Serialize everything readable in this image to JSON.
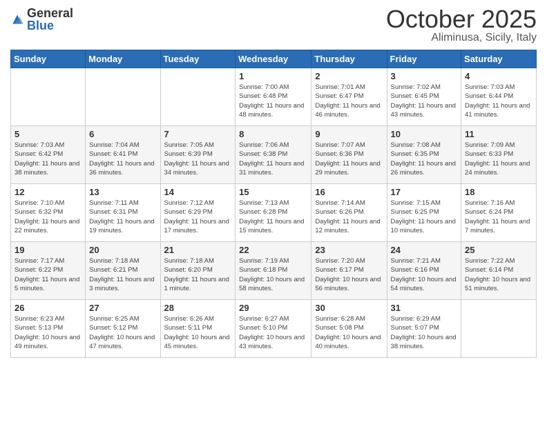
{
  "logo": {
    "general": "General",
    "blue": "Blue"
  },
  "header": {
    "month": "October 2025",
    "location": "Aliminusa, Sicily, Italy"
  },
  "weekdays": [
    "Sunday",
    "Monday",
    "Tuesday",
    "Wednesday",
    "Thursday",
    "Friday",
    "Saturday"
  ],
  "weeks": [
    [
      {
        "day": "",
        "info": ""
      },
      {
        "day": "",
        "info": ""
      },
      {
        "day": "",
        "info": ""
      },
      {
        "day": "1",
        "info": "Sunrise: 7:00 AM\nSunset: 6:48 PM\nDaylight: 11 hours\nand 48 minutes."
      },
      {
        "day": "2",
        "info": "Sunrise: 7:01 AM\nSunset: 6:47 PM\nDaylight: 11 hours\nand 46 minutes."
      },
      {
        "day": "3",
        "info": "Sunrise: 7:02 AM\nSunset: 6:45 PM\nDaylight: 11 hours\nand 43 minutes."
      },
      {
        "day": "4",
        "info": "Sunrise: 7:03 AM\nSunset: 6:44 PM\nDaylight: 11 hours\nand 41 minutes."
      }
    ],
    [
      {
        "day": "5",
        "info": "Sunrise: 7:03 AM\nSunset: 6:42 PM\nDaylight: 11 hours\nand 38 minutes."
      },
      {
        "day": "6",
        "info": "Sunrise: 7:04 AM\nSunset: 6:41 PM\nDaylight: 11 hours\nand 36 minutes."
      },
      {
        "day": "7",
        "info": "Sunrise: 7:05 AM\nSunset: 6:39 PM\nDaylight: 11 hours\nand 34 minutes."
      },
      {
        "day": "8",
        "info": "Sunrise: 7:06 AM\nSunset: 6:38 PM\nDaylight: 11 hours\nand 31 minutes."
      },
      {
        "day": "9",
        "info": "Sunrise: 7:07 AM\nSunset: 6:36 PM\nDaylight: 11 hours\nand 29 minutes."
      },
      {
        "day": "10",
        "info": "Sunrise: 7:08 AM\nSunset: 6:35 PM\nDaylight: 11 hours\nand 26 minutes."
      },
      {
        "day": "11",
        "info": "Sunrise: 7:09 AM\nSunset: 6:33 PM\nDaylight: 11 hours\nand 24 minutes."
      }
    ],
    [
      {
        "day": "12",
        "info": "Sunrise: 7:10 AM\nSunset: 6:32 PM\nDaylight: 11 hours\nand 22 minutes."
      },
      {
        "day": "13",
        "info": "Sunrise: 7:11 AM\nSunset: 6:31 PM\nDaylight: 11 hours\nand 19 minutes."
      },
      {
        "day": "14",
        "info": "Sunrise: 7:12 AM\nSunset: 6:29 PM\nDaylight: 11 hours\nand 17 minutes."
      },
      {
        "day": "15",
        "info": "Sunrise: 7:13 AM\nSunset: 6:28 PM\nDaylight: 11 hours\nand 15 minutes."
      },
      {
        "day": "16",
        "info": "Sunrise: 7:14 AM\nSunset: 6:26 PM\nDaylight: 11 hours\nand 12 minutes."
      },
      {
        "day": "17",
        "info": "Sunrise: 7:15 AM\nSunset: 6:25 PM\nDaylight: 11 hours\nand 10 minutes."
      },
      {
        "day": "18",
        "info": "Sunrise: 7:16 AM\nSunset: 6:24 PM\nDaylight: 11 hours\nand 7 minutes."
      }
    ],
    [
      {
        "day": "19",
        "info": "Sunrise: 7:17 AM\nSunset: 6:22 PM\nDaylight: 11 hours\nand 5 minutes."
      },
      {
        "day": "20",
        "info": "Sunrise: 7:18 AM\nSunset: 6:21 PM\nDaylight: 11 hours\nand 3 minutes."
      },
      {
        "day": "21",
        "info": "Sunrise: 7:18 AM\nSunset: 6:20 PM\nDaylight: 11 hours\nand 1 minute."
      },
      {
        "day": "22",
        "info": "Sunrise: 7:19 AM\nSunset: 6:18 PM\nDaylight: 10 hours\nand 58 minutes."
      },
      {
        "day": "23",
        "info": "Sunrise: 7:20 AM\nSunset: 6:17 PM\nDaylight: 10 hours\nand 56 minutes."
      },
      {
        "day": "24",
        "info": "Sunrise: 7:21 AM\nSunset: 6:16 PM\nDaylight: 10 hours\nand 54 minutes."
      },
      {
        "day": "25",
        "info": "Sunrise: 7:22 AM\nSunset: 6:14 PM\nDaylight: 10 hours\nand 51 minutes."
      }
    ],
    [
      {
        "day": "26",
        "info": "Sunrise: 6:23 AM\nSunset: 5:13 PM\nDaylight: 10 hours\nand 49 minutes."
      },
      {
        "day": "27",
        "info": "Sunrise: 6:25 AM\nSunset: 5:12 PM\nDaylight: 10 hours\nand 47 minutes."
      },
      {
        "day": "28",
        "info": "Sunrise: 6:26 AM\nSunset: 5:11 PM\nDaylight: 10 hours\nand 45 minutes."
      },
      {
        "day": "29",
        "info": "Sunrise: 6:27 AM\nSunset: 5:10 PM\nDaylight: 10 hours\nand 43 minutes."
      },
      {
        "day": "30",
        "info": "Sunrise: 6:28 AM\nSunset: 5:08 PM\nDaylight: 10 hours\nand 40 minutes."
      },
      {
        "day": "31",
        "info": "Sunrise: 6:29 AM\nSunset: 5:07 PM\nDaylight: 10 hours\nand 38 minutes."
      },
      {
        "day": "",
        "info": ""
      }
    ]
  ]
}
